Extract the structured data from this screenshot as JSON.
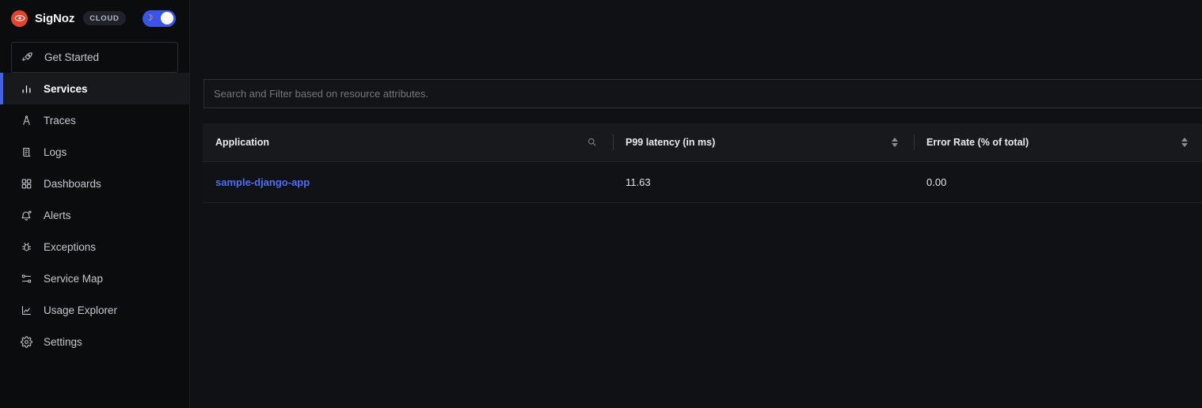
{
  "brand": {
    "logo_icon": "signoz-eye-logo",
    "name": "SigNoz",
    "badge": "CLOUD",
    "theme_toggle": {
      "icon": "moon-icon",
      "glyph": "☽",
      "state": "on",
      "accent_color": "#3b54e8"
    }
  },
  "sidebar": {
    "items": [
      {
        "label": "Get Started",
        "icon": "rocket-icon",
        "active": false,
        "boxed": true
      },
      {
        "label": "Services",
        "icon": "bar-chart-icon",
        "active": true,
        "boxed": false
      },
      {
        "label": "Traces",
        "icon": "compass-icon",
        "active": false,
        "boxed": false
      },
      {
        "label": "Logs",
        "icon": "scroll-icon",
        "active": false,
        "boxed": false
      },
      {
        "label": "Dashboards",
        "icon": "grid-icon",
        "active": false,
        "boxed": false
      },
      {
        "label": "Alerts",
        "icon": "bell-dot-icon",
        "active": false,
        "boxed": false
      },
      {
        "label": "Exceptions",
        "icon": "bug-icon",
        "active": false,
        "boxed": false
      },
      {
        "label": "Service Map",
        "icon": "network-nodes-icon",
        "active": false,
        "boxed": false
      },
      {
        "label": "Usage Explorer",
        "icon": "area-chart-icon",
        "active": false,
        "boxed": false
      },
      {
        "label": "Settings",
        "icon": "gear-icon",
        "active": false,
        "boxed": false
      }
    ]
  },
  "search": {
    "value": "",
    "placeholder": "Search and Filter based on resource attributes."
  },
  "table": {
    "columns": [
      {
        "label": "Application",
        "control": "search-icon"
      },
      {
        "label": "P99 latency (in ms)",
        "control": "sort-icon"
      },
      {
        "label": "Error Rate (% of total)",
        "control": "sort-icon"
      }
    ],
    "rows": [
      {
        "application": "sample-django-app",
        "p99_latency": "11.63",
        "error_rate": "0.00"
      }
    ]
  },
  "colors": {
    "accent_blue": "#4361ee",
    "link_blue": "#4d6ef5",
    "logo_red": "#e5442b",
    "sidebar_bg": "#0b0c0e",
    "main_bg": "#101114"
  }
}
